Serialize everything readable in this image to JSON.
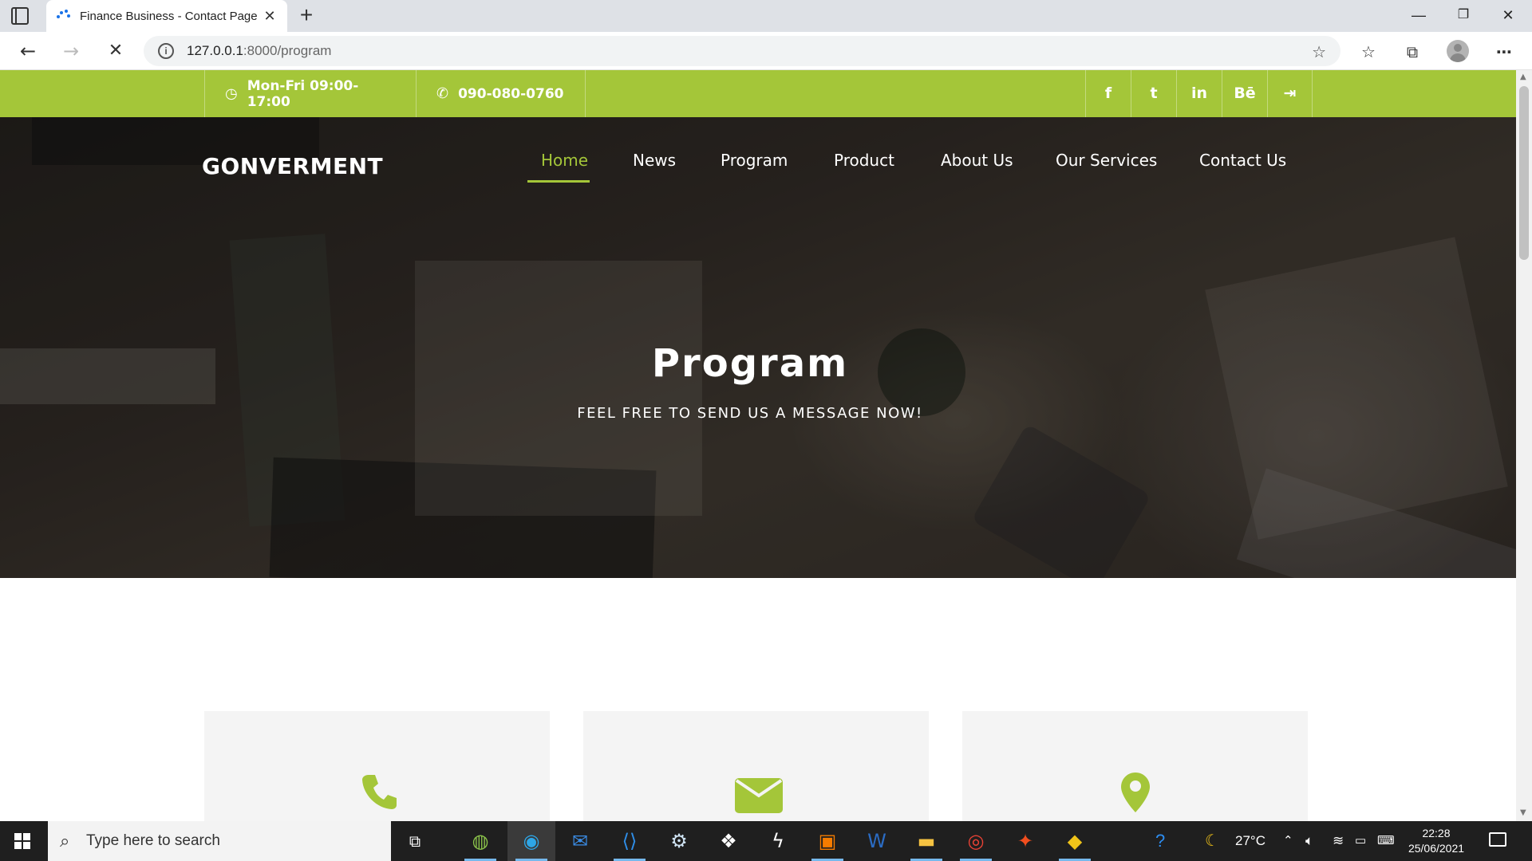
{
  "browser": {
    "tab_title": "Finance Business - Contact Page",
    "tab_close": "✕",
    "new_tab": "+",
    "url_host": "127.0.0.1",
    "url_path": ":8000/program",
    "window": {
      "minimize": "—",
      "restore": "❐",
      "close": "✕"
    }
  },
  "topbar": {
    "hours": "Mon-Fri 09:00-17:00",
    "phone": "090-080-0760",
    "social": [
      "f",
      "t",
      "in",
      "Bē",
      "⇥"
    ]
  },
  "site": {
    "logo": "GONVERMENT",
    "menu": [
      "Home",
      "News",
      "Program",
      "Product",
      "About Us",
      "Our Services",
      "Contact Us"
    ],
    "active_menu": "Home"
  },
  "hero": {
    "title": "Program",
    "subtitle": "FEEL FREE TO SEND US A MESSAGE NOW!"
  },
  "cards": [
    {
      "icon": "phone-icon"
    },
    {
      "icon": "envelope-icon"
    },
    {
      "icon": "map-marker-icon"
    }
  ],
  "taskbar": {
    "search_placeholder": "Type here to search",
    "temperature": "27°C",
    "time": "22:28",
    "date": "25/06/2021"
  },
  "colors": {
    "accent": "#a4c639"
  }
}
